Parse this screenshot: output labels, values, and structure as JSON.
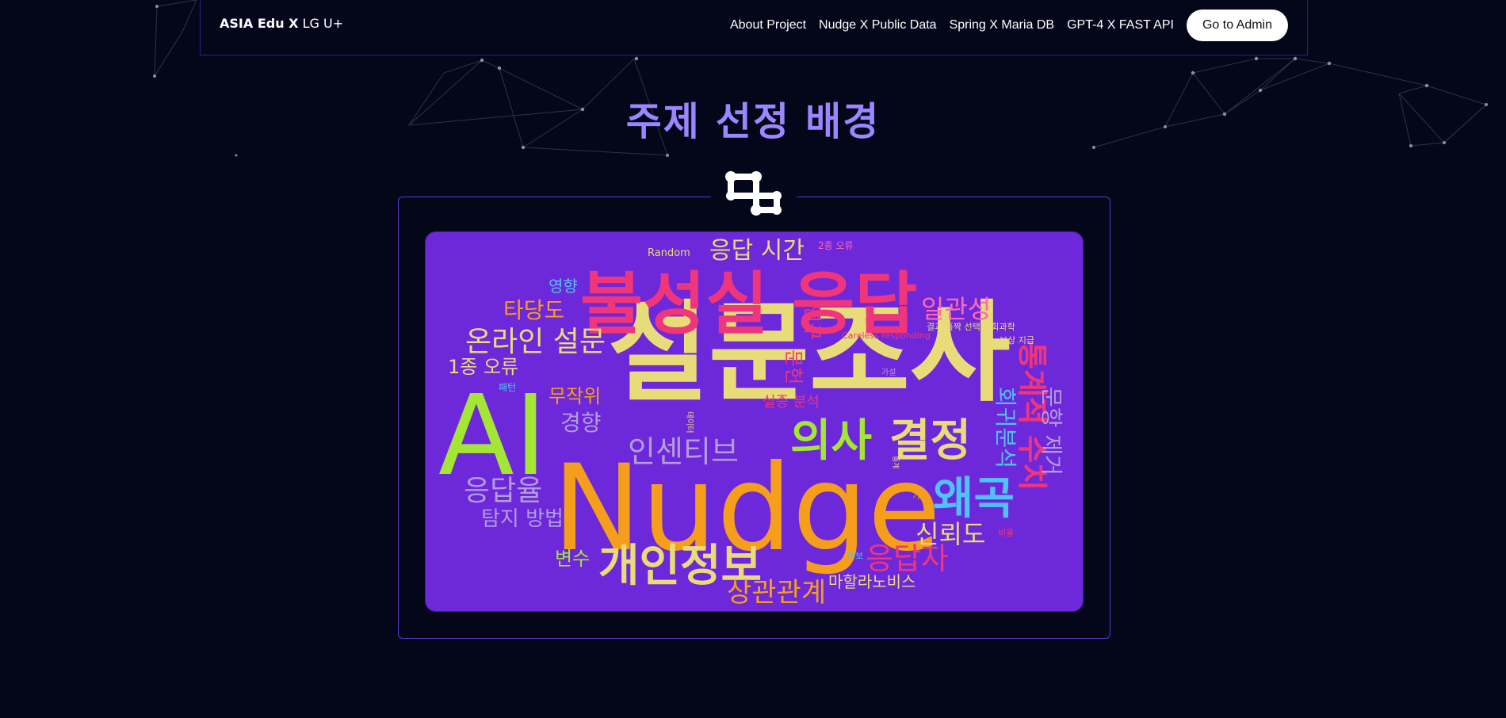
{
  "nav": {
    "brand_bold": "ASIA Edu X",
    "brand_light": "LG U+",
    "links": [
      "About Project",
      "Nudge X Public Data",
      "Spring X Maria DB",
      "GPT-4 X FAST API"
    ],
    "admin_button": "Go to Admin"
  },
  "section": {
    "title": "주제 선정 배경"
  },
  "icons": {
    "frame_icon": "hierarchy-nodes-icon"
  },
  "colors": {
    "background": "#04061a",
    "title": "#9b86ff",
    "cloud_bg": "#6d28d9",
    "frame_border": "#5a3bd6"
  },
  "wordcloud": {
    "words": [
      {
        "text": "설문조사",
        "color": "#e8dc7a"
      },
      {
        "text": "Nudge",
        "color": "#f59e1b"
      },
      {
        "text": "AI",
        "color": "#a3e635"
      },
      {
        "text": "불성실 응답",
        "color": "#f0367a"
      },
      {
        "text": "의사",
        "color": "#a3e635"
      },
      {
        "text": "결정",
        "color": "#e8dc7a"
      },
      {
        "text": "왜곡",
        "color": "#4fc3f7"
      },
      {
        "text": "개인정보",
        "color": "#e8dc7a"
      },
      {
        "text": "응답 시간",
        "color": "#e8dc7a"
      },
      {
        "text": "온라인 설문",
        "color": "#e8dc7a"
      },
      {
        "text": "인센티브",
        "color": "#b39ddb"
      },
      {
        "text": "일관성",
        "color": "#ff69b4"
      },
      {
        "text": "타당도",
        "color": "#f59e1b"
      },
      {
        "text": "응답율",
        "color": "#b39ddb"
      },
      {
        "text": "신뢰도",
        "color": "#e8dc7a"
      },
      {
        "text": "응답자",
        "color": "#f0367a"
      },
      {
        "text": "상관관계",
        "color": "#f59e1b"
      },
      {
        "text": "탐지 방법",
        "color": "#b39ddb"
      },
      {
        "text": "경향",
        "color": "#b39ddb"
      },
      {
        "text": "무작위",
        "color": "#f59e1b"
      },
      {
        "text": "1종 오류",
        "color": "#e8dc7a"
      },
      {
        "text": "변수",
        "color": "#a3e635"
      },
      {
        "text": "마할라노비스",
        "color": "#e8dc7a"
      },
      {
        "text": "영향",
        "color": "#4fc3f7"
      },
      {
        "text": "Random",
        "color": "#e8dc7a"
      },
      {
        "text": "2종 오류",
        "color": "#ff69b4"
      },
      {
        "text": "연구",
        "color": "#f0367a"
      },
      {
        "text": "문헌",
        "color": "#f0367a"
      },
      {
        "text": "실증 분석",
        "color": "#f0367a"
      },
      {
        "text": "통계적 수치",
        "color": "#f0367a"
      },
      {
        "text": "회귀분석",
        "color": "#4fc3f7"
      },
      {
        "text": "문항 제거",
        "color": "#b39ddb"
      },
      {
        "text": "Careless responding",
        "color": "#f0367a"
      },
      {
        "text": "결과 홀짝 선택 사회과학",
        "color": "#e8dc7a"
      },
      {
        "text": "보상 지급",
        "color": "#e8dc7a"
      },
      {
        "text": "가설",
        "color": "#b39ddb"
      },
      {
        "text": "패턴",
        "color": "#4fc3f7"
      },
      {
        "text": "데이터",
        "color": "#e8dc7a"
      },
      {
        "text": "통계",
        "color": "#e8dc7a"
      },
      {
        "text": "가짜",
        "color": "#f59e1b"
      },
      {
        "text": "비율",
        "color": "#f0367a"
      },
      {
        "text": "정보",
        "color": "#4fc3f7"
      }
    ]
  }
}
